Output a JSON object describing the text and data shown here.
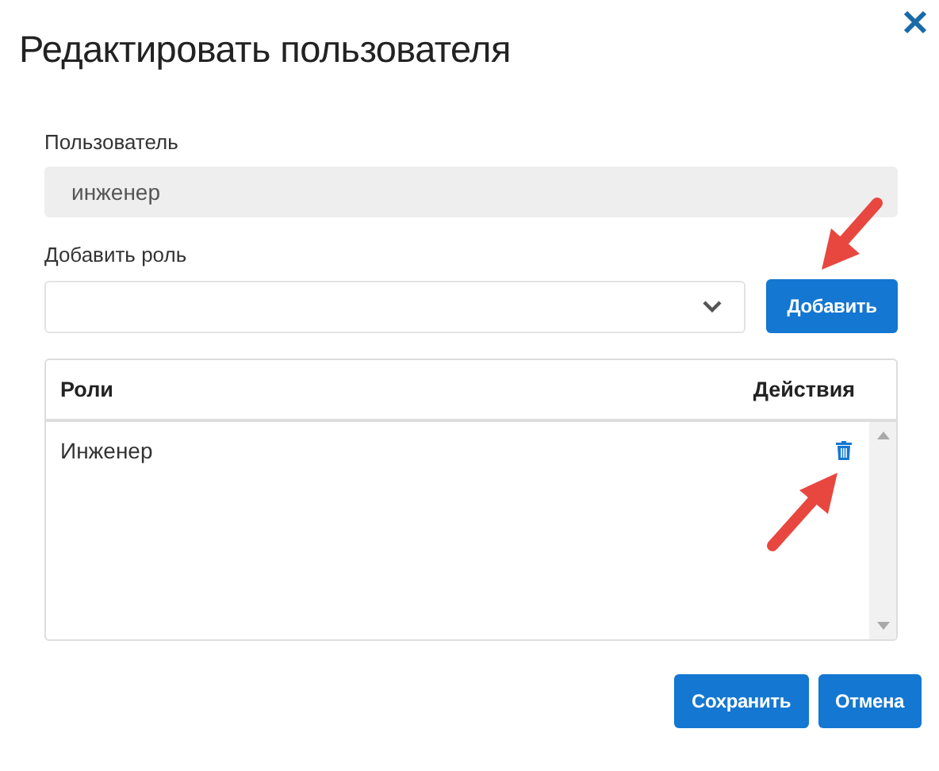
{
  "dialog": {
    "title": "Редактировать пользователя"
  },
  "user_field": {
    "label": "Пользователь",
    "value": "инженер",
    "readonly": true
  },
  "role_select": {
    "label": "Добавить роль"
  },
  "add_button": {
    "label": "Добавить"
  },
  "table": {
    "columns": [
      "Роли",
      "Действия"
    ],
    "rows": [
      {
        "role": "Инженер"
      }
    ]
  },
  "footer_buttons": [
    {
      "label": "Сохранить"
    },
    {
      "label": "Отмена"
    }
  ]
}
